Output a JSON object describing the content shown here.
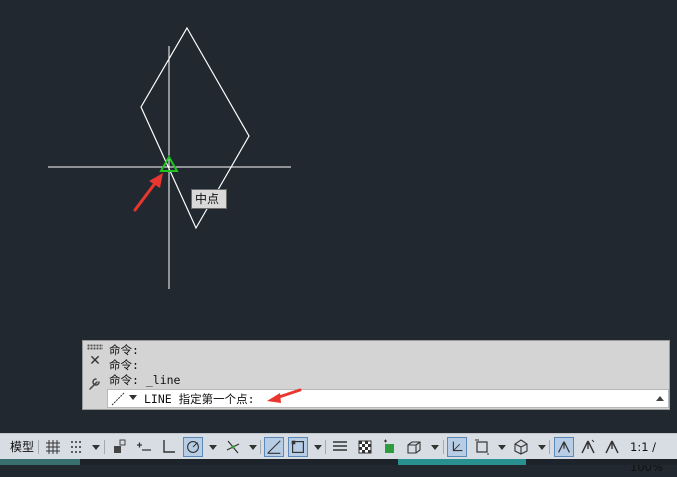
{
  "tooltip": {
    "text": "中点"
  },
  "command_window": {
    "history": [
      "命令:",
      "命令:",
      "命令: _line"
    ],
    "prompt": "LINE 指定第一个点:"
  },
  "statusbar": {
    "model_label": "模型",
    "scale_label": "1:1 / 100%"
  },
  "colors": {
    "background": "#212830",
    "geometry": "#ffffff",
    "snap_marker": "#1fc41f",
    "arrow": "#e8372f",
    "active_toggle": "#b7cde6"
  },
  "icons": [
    "grid-icon",
    "snap-icon",
    "infer-constraints-icon",
    "dynamic-input-icon",
    "ortho-icon",
    "polar-icon",
    "isodraft-icon",
    "object-snap-tracking-icon",
    "object-snap-icon",
    "lineweight-icon",
    "transparency-icon",
    "selection-cycling-icon",
    "3d-osnap-icon",
    "dynamic-ucs-icon",
    "selection-filter-icon",
    "gizmo-icon",
    "annotation-visibility-icon",
    "auto-scale-icon",
    "annotation-scale-icon"
  ]
}
